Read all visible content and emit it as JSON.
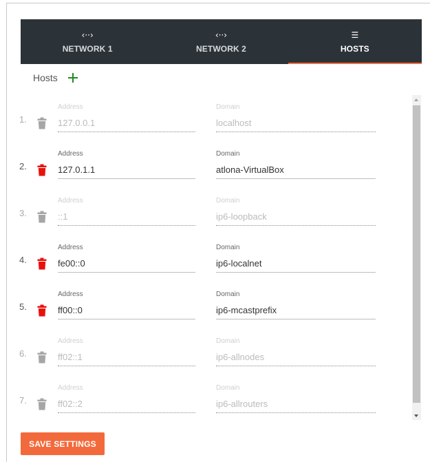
{
  "tabs": [
    {
      "icon": "code-brackets-icon",
      "glyph": "‹··›",
      "label": "NETWORK 1",
      "active": false
    },
    {
      "icon": "code-brackets-icon",
      "glyph": "‹··›",
      "label": "NETWORK 2",
      "active": false
    },
    {
      "icon": "list-icon",
      "glyph": "☰",
      "label": "HOSTS",
      "active": true
    }
  ],
  "hosts": {
    "title": "Hosts",
    "add_icon": "plus-icon",
    "address_label": "Address",
    "domain_label": "Domain",
    "rows": [
      {
        "num": "1.",
        "address": "127.0.0.1",
        "domain": "localhost",
        "editable": false
      },
      {
        "num": "2.",
        "address": "127.0.1.1",
        "domain": "atlona-VirtualBox",
        "editable": true
      },
      {
        "num": "3.",
        "address": "::1",
        "domain": "ip6-loopback",
        "editable": false
      },
      {
        "num": "4.",
        "address": "fe00::0",
        "domain": "ip6-localnet",
        "editable": true
      },
      {
        "num": "5.",
        "address": "ff00::0",
        "domain": "ip6-mcastprefix",
        "editable": true
      },
      {
        "num": "6.",
        "address": "ff02::1",
        "domain": "ip6-allnodes",
        "editable": false
      },
      {
        "num": "7.",
        "address": "ff02::2",
        "domain": "ip6-allrouters",
        "editable": false
      }
    ]
  },
  "save_label": "SAVE SETTINGS",
  "colors": {
    "accent": "#f26a3c",
    "tabbar_bg": "#2c3338",
    "delete_active": "#e8120c",
    "delete_disabled": "#a6a6a6",
    "add": "#1f8a1f"
  }
}
